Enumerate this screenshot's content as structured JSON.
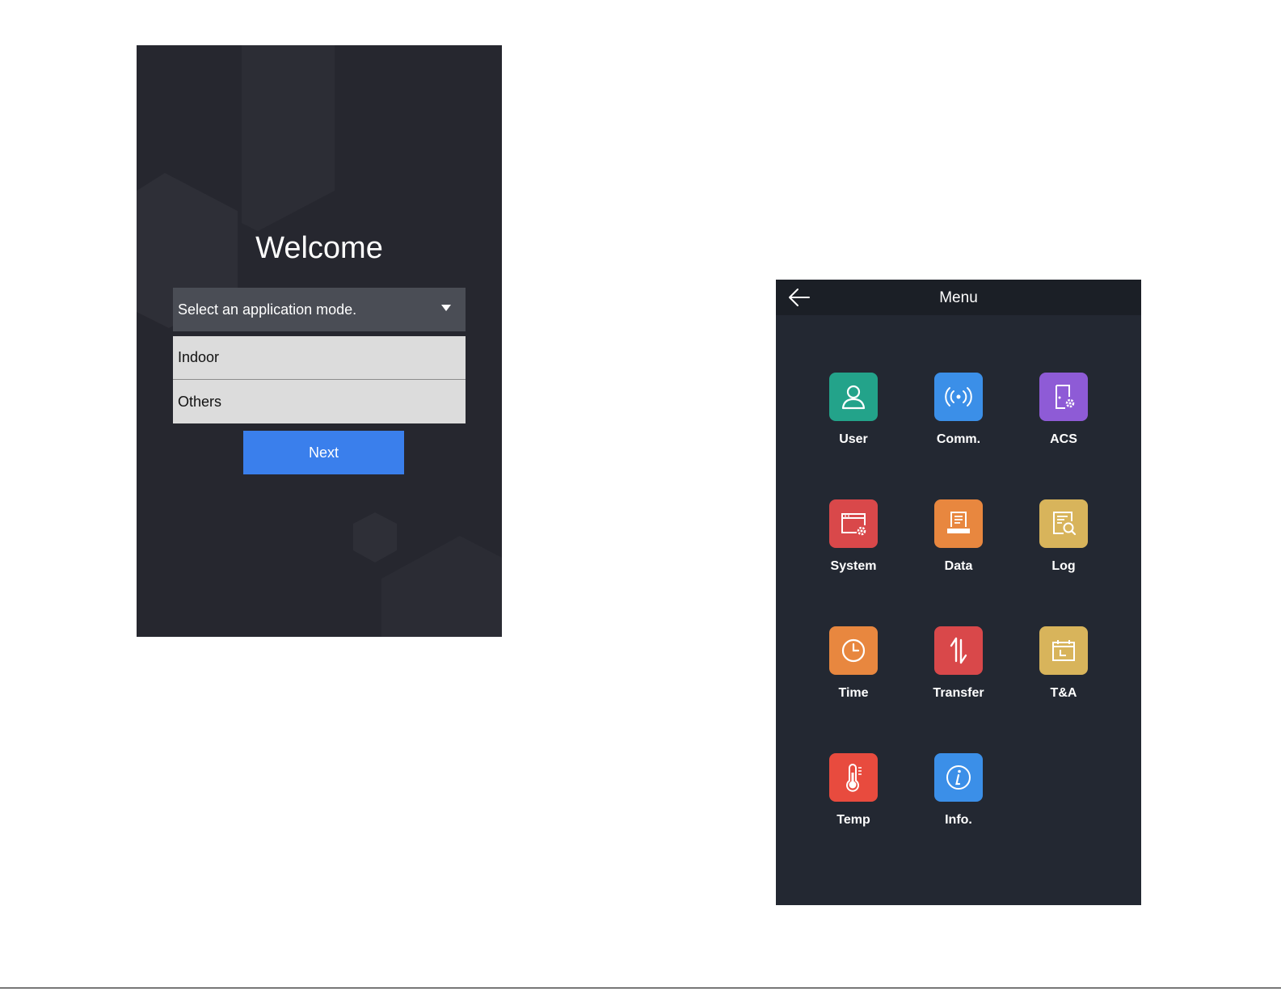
{
  "welcome": {
    "title": "Welcome",
    "select_placeholder": "Select an application mode.",
    "options": [
      "Indoor",
      "Others"
    ],
    "next_label": "Next"
  },
  "menu": {
    "title": "Menu",
    "items": [
      {
        "label": "User",
        "icon": "user-icon",
        "color": "#23a38a"
      },
      {
        "label": "Comm.",
        "icon": "comm-icon",
        "color": "#3b8fe8"
      },
      {
        "label": "ACS",
        "icon": "acs-icon",
        "color": "#8e5bd6"
      },
      {
        "label": "System",
        "icon": "system-icon",
        "color": "#d9484a"
      },
      {
        "label": "Data",
        "icon": "data-icon",
        "color": "#e8873f"
      },
      {
        "label": "Log",
        "icon": "log-icon",
        "color": "#d8b45b"
      },
      {
        "label": "Time",
        "icon": "clock-icon",
        "color": "#e8873f"
      },
      {
        "label": "Transfer",
        "icon": "transfer-icon",
        "color": "#d9484a"
      },
      {
        "label": "T&A",
        "icon": "calendar-icon",
        "color": "#d8b45b"
      },
      {
        "label": "Temp",
        "icon": "thermometer-icon",
        "color": "#e84b3e"
      },
      {
        "label": "Info.",
        "icon": "info-icon",
        "color": "#3b8fe8"
      }
    ]
  }
}
